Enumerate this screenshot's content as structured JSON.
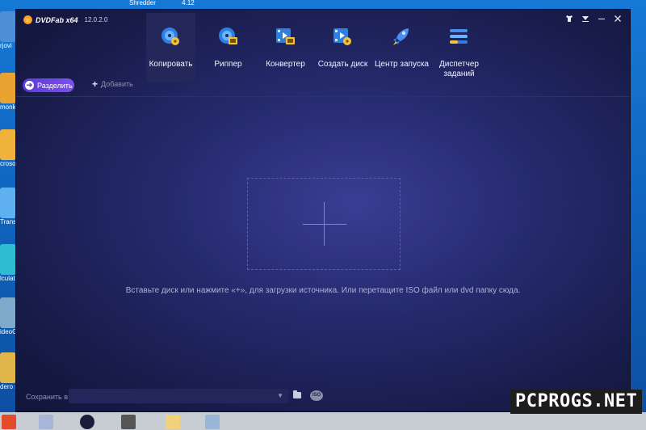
{
  "desktop": {
    "top_strip": [
      "Shredder",
      "4.12"
    ],
    "icons": [
      {
        "label": "rjovi",
        "color": "#4d8fd6"
      },
      {
        "label": "monk",
        "color": "#e9a330"
      },
      {
        "label": "croso cious",
        "color": "#f0b23a"
      },
      {
        "label": "Trans",
        "color": "#5fb0ef"
      },
      {
        "label": "lculat yline",
        "color": "#2dbcd1"
      },
      {
        "label": "ideoG",
        "color": "#7fa9c8"
      },
      {
        "label": "dero show",
        "color": "#e0b54a"
      }
    ]
  },
  "app": {
    "brand_name": "DVDFab x64",
    "version": "12.0.2.0",
    "window_controls": [
      "shirt-icon",
      "menu-icon",
      "minimize-icon",
      "close-icon"
    ],
    "modules": [
      {
        "label": "Копировать",
        "icon": "disc-copy-icon",
        "active": true
      },
      {
        "label": "Риппер",
        "icon": "disc-ripper-icon",
        "active": false
      },
      {
        "label": "Конвертер",
        "icon": "film-converter-icon",
        "active": false
      },
      {
        "label": "Создать диск",
        "icon": "film-disc-creator-icon",
        "active": false
      },
      {
        "label": "Центр запуска",
        "icon": "rocket-icon",
        "active": false
      },
      {
        "label": "Диспетчер заданий",
        "icon": "task-list-icon",
        "active": false
      }
    ],
    "toolbar": {
      "split_label": "Разделить",
      "add_label": "Добавить"
    },
    "drop_hint": "Вставьте диск или нажмите «+», для загрузки источника. Или перетащите ISO файл или dvd папку сюда.",
    "save": {
      "label": "Сохранить в:",
      "path_value": "",
      "iso_label": "ISO"
    },
    "colors": {
      "accent_purple": "#6a46e6",
      "plus_blue": "#3aa0ef"
    }
  },
  "watermark": "PCPROGS.NET"
}
